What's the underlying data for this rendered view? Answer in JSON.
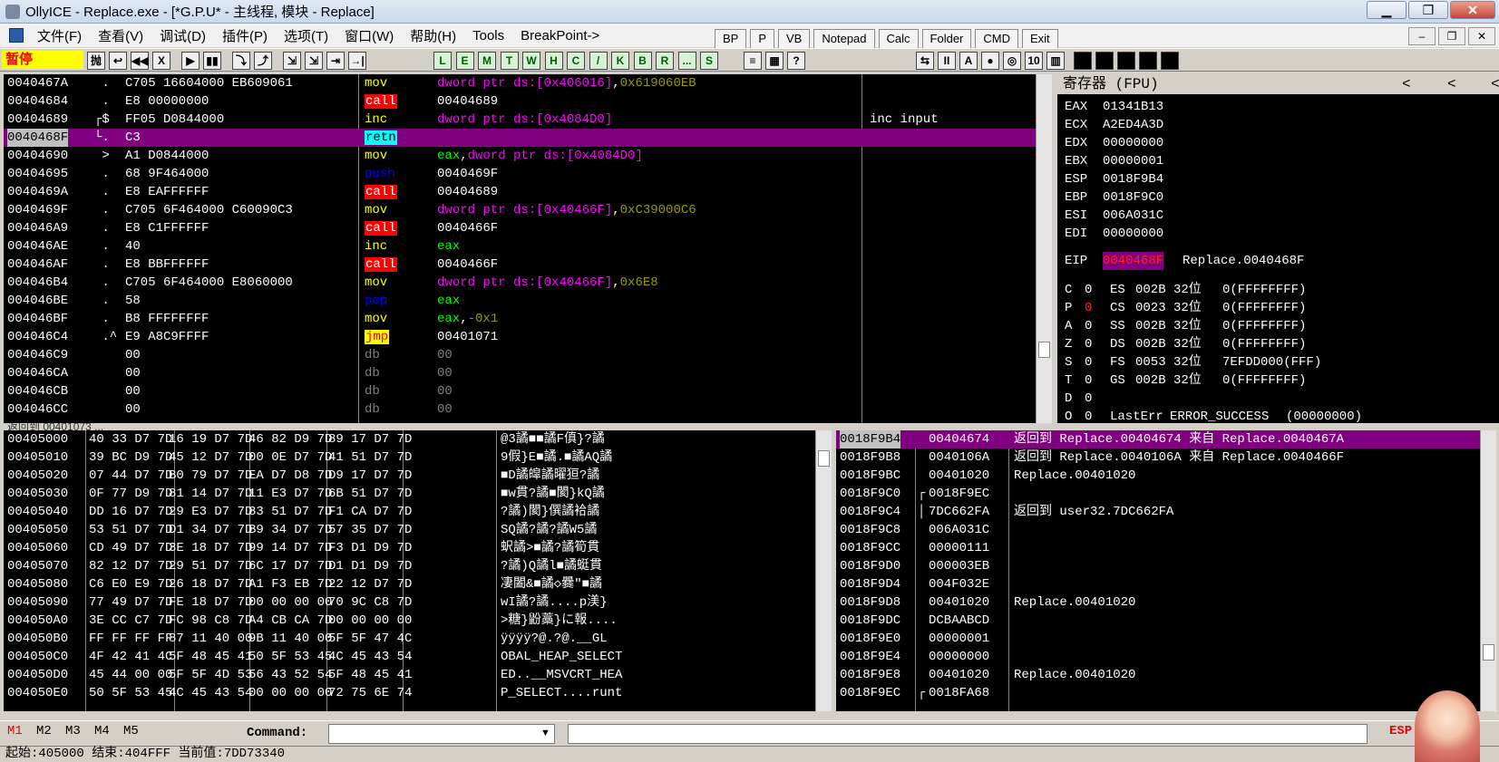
{
  "title": "OllyICE - Replace.exe - [*G.P.U* - 主线程, 模块 - Replace]",
  "window_buttons": {
    "min": "▁",
    "max": "❐",
    "close": "✕"
  },
  "menu": [
    "文件(F)",
    "查看(V)",
    "调试(D)",
    "插件(P)",
    "选项(T)",
    "窗口(W)",
    "帮助(H)",
    "Tools",
    "BreakPoint->"
  ],
  "top_buttons": [
    "BP",
    "P",
    "VB",
    "Notepad",
    "Calc",
    "Folder",
    "CMD",
    "Exit"
  ],
  "mdi_buttons": [
    "–",
    "❐",
    "✕"
  ],
  "status": {
    "paused": "暂停"
  },
  "toolbar": {
    "left": [
      "抛",
      "↩",
      "◀◀",
      "X",
      "▶",
      "▮▮",
      "⤵",
      "⤴",
      "⇲",
      "⇲",
      "⇥",
      "→|"
    ],
    "letters": [
      "L",
      "E",
      "M",
      "T",
      "W",
      "H",
      "C",
      "/",
      "K",
      "B",
      "R",
      "...",
      "S"
    ],
    "right": [
      "≡",
      "▦",
      "?"
    ],
    "right2": [
      "⇆",
      "II",
      "A",
      "●",
      "◎",
      "10",
      "▥"
    ]
  },
  "disasm": {
    "rows": [
      {
        "addr": "0040467A",
        "mark": " .",
        "hex": "C705 16604000 EB609061",
        "op": "mov",
        "args": [
          {
            "t": "dword ptr ds:[0x406016]",
            "c": "#ff00ff"
          },
          {
            "t": ",",
            "c": "#fff"
          },
          {
            "t": "0x619060EB",
            "c": "#9a9a00"
          }
        ],
        "cmt": ""
      },
      {
        "addr": "00404684",
        "mark": " .",
        "hex": "E8 00000000",
        "op": "call",
        "opk": "mk",
        "args": [
          {
            "t": "00404689",
            "c": "#fff"
          }
        ],
        "cmt": ""
      },
      {
        "addr": "00404689",
        "mark": "┌$",
        "hex": "FF05 D0844000",
        "op": "inc",
        "args": [
          {
            "t": "dword ptr ds:[0x4084D0]",
            "c": "#ff00ff"
          }
        ],
        "cmt": "inc input"
      },
      {
        "addr": "0040468F",
        "mark": "└.",
        "hex": "C3",
        "op": "retn",
        "opk": "mkr",
        "args": [],
        "cmt": "",
        "sel": true
      },
      {
        "addr": "00404690",
        "mark": " >",
        "hex": "A1 D0844000",
        "op": "mov",
        "args": [
          {
            "t": "eax",
            "c": "#00ff00"
          },
          {
            "t": ",",
            "c": "#fff"
          },
          {
            "t": "dword ptr ds:[0x4084D0]",
            "c": "#ff00ff"
          }
        ],
        "cmt": ""
      },
      {
        "addr": "00404695",
        "mark": " .",
        "hex": "68 9F464000",
        "op": "push",
        "opc": "#0000ff",
        "args": [
          {
            "t": "0040469F",
            "c": "#fff"
          }
        ],
        "cmt": ""
      },
      {
        "addr": "0040469A",
        "mark": " .",
        "hex": "E8 EAFFFFFF",
        "op": "call",
        "opk": "mk",
        "args": [
          {
            "t": "00404689",
            "c": "#fff"
          }
        ],
        "cmt": ""
      },
      {
        "addr": "0040469F",
        "mark": " .",
        "hex": "C705 6F464000 C60090C3",
        "op": "mov",
        "args": [
          {
            "t": "dword ptr ds:[0x40466F]",
            "c": "#ff00ff"
          },
          {
            "t": ",",
            "c": "#fff"
          },
          {
            "t": "0xC39000C6",
            "c": "#9a9a00"
          }
        ],
        "cmt": ""
      },
      {
        "addr": "004046A9",
        "mark": " .",
        "hex": "E8 C1FFFFFF",
        "op": "call",
        "opk": "mk",
        "args": [
          {
            "t": "0040466F",
            "c": "#fff"
          }
        ],
        "cmt": ""
      },
      {
        "addr": "004046AE",
        "mark": " .",
        "hex": "40",
        "op": "inc",
        "args": [
          {
            "t": "eax",
            "c": "#00ff00"
          }
        ],
        "cmt": ""
      },
      {
        "addr": "004046AF",
        "mark": " .",
        "hex": "E8 BBFFFFFF",
        "op": "call",
        "opk": "mk",
        "args": [
          {
            "t": "0040466F",
            "c": "#fff"
          }
        ],
        "cmt": ""
      },
      {
        "addr": "004046B4",
        "mark": " .",
        "hex": "C705 6F464000 E8060000",
        "op": "mov",
        "args": [
          {
            "t": "dword ptr ds:[0x40466F]",
            "c": "#ff00ff"
          },
          {
            "t": ",",
            "c": "#fff"
          },
          {
            "t": "0x6E8",
            "c": "#9a9a00"
          }
        ],
        "cmt": ""
      },
      {
        "addr": "004046BE",
        "mark": " .",
        "hex": "58",
        "op": "pop",
        "opc": "#0000ff",
        "args": [
          {
            "t": "eax",
            "c": "#00ff00"
          }
        ],
        "cmt": ""
      },
      {
        "addr": "004046BF",
        "mark": " .",
        "hex": "B8 FFFFFFFF",
        "op": "mov",
        "args": [
          {
            "t": "eax",
            "c": "#00ff00"
          },
          {
            "t": ",",
            "c": "#fff"
          },
          {
            "t": "-0x1",
            "c": "#9a9a00"
          }
        ],
        "cmt": ""
      },
      {
        "addr": "004046C4",
        "mark": " .^",
        "hex": "E9 A8C9FFFF",
        "op": "jmp",
        "opk": "mkj",
        "args": [
          {
            "t": "00401071",
            "c": "#fff"
          }
        ],
        "cmt": ""
      },
      {
        "addr": "004046C9",
        "mark": "",
        "hex": "00",
        "op": "db",
        "opc": "#808080",
        "args": [
          {
            "t": "00",
            "c": "#808080"
          }
        ],
        "cmt": ""
      },
      {
        "addr": "004046CA",
        "mark": "",
        "hex": "00",
        "op": "db",
        "opc": "#808080",
        "args": [
          {
            "t": "00",
            "c": "#808080"
          }
        ],
        "cmt": ""
      },
      {
        "addr": "004046CB",
        "mark": "",
        "hex": "00",
        "op": "db",
        "opc": "#808080",
        "args": [
          {
            "t": "00",
            "c": "#808080"
          }
        ],
        "cmt": ""
      },
      {
        "addr": "004046CC",
        "mark": "",
        "hex": "00",
        "op": "db",
        "opc": "#808080",
        "args": [
          {
            "t": "00",
            "c": "#808080"
          }
        ],
        "cmt": ""
      }
    ]
  },
  "registers": {
    "title": "寄存器 (FPU)",
    "nav": [
      "<",
      "<",
      "<"
    ],
    "gpr": [
      [
        "EAX",
        "01341B13"
      ],
      [
        "ECX",
        "A2ED4A3D"
      ],
      [
        "EDX",
        "00000000"
      ],
      [
        "EBX",
        "00000001"
      ],
      [
        "ESP",
        "0018F9B4"
      ],
      [
        "EBP",
        "0018F9C0"
      ],
      [
        "ESI",
        "006A031C"
      ],
      [
        "EDI",
        "00000000"
      ]
    ],
    "eip": {
      "name": "EIP",
      "value": "0040468F",
      "desc": "Replace.0040468F"
    },
    "flags": [
      {
        "f": "C",
        "v": "0",
        "seg": "ES",
        "sv": "002B",
        "bits": "32位",
        "rest": "0(FFFFFFFF)"
      },
      {
        "f": "P",
        "v": "0",
        "seg": "CS",
        "sv": "0023",
        "bits": "32位",
        "rest": "0(FFFFFFFF)",
        "red": true
      },
      {
        "f": "A",
        "v": "0",
        "seg": "SS",
        "sv": "002B",
        "bits": "32位",
        "rest": "0(FFFFFFFF)"
      },
      {
        "f": "Z",
        "v": "0",
        "seg": "DS",
        "sv": "002B",
        "bits": "32位",
        "rest": "0(FFFFFFFF)"
      },
      {
        "f": "S",
        "v": "0",
        "seg": "FS",
        "sv": "0053",
        "bits": "32位",
        "rest": "7EFDD000(FFF)"
      },
      {
        "f": "T",
        "v": "0",
        "seg": "GS",
        "sv": "002B",
        "bits": "32位",
        "rest": "0(FFFFFFFF)"
      },
      {
        "f": "D",
        "v": "0",
        "seg": "",
        "sv": "",
        "bits": "",
        "rest": ""
      },
      {
        "f": "O",
        "v": "0",
        "seg": "LastErr",
        "sv": "ERROR_SUCCESS",
        "bits": "",
        "rest": "(00000000)"
      }
    ]
  },
  "info_line": "返回到 00401073 ...",
  "dump": {
    "rows": [
      {
        "a": "00405000",
        "h": [
          "40 33 D7 7D",
          "16 19 D7 7D",
          "46 82 D9 7D",
          "89 17 D7 7D"
        ],
        "s": "@3譎■■譎F傎}?譎"
      },
      {
        "a": "00405010",
        "h": [
          "39 BC D9 7D",
          "45 12 D7 7D",
          "00 0E D7 7D",
          "41 51 D7 7D"
        ],
        "s": "9假}E■譎.■譎AQ譎"
      },
      {
        "a": "00405020",
        "h": [
          "07 44 D7 7D",
          "B0 79 D7 7D",
          "EA D7 D8 7D",
          "D9 17 D7 7D"
        ],
        "s": "■D譎皡譎曜狟?譎"
      },
      {
        "a": "00405030",
        "h": [
          "0F 77 D9 7D",
          "81 14 D7 7D",
          "11 E3 D7 7D",
          "6B 51 D7 7D"
        ],
        "s": "■w貫?譎■閡}kQ譎"
      },
      {
        "a": "00405040",
        "h": [
          "DD 16 D7 7D",
          "29 E3 D7 7D",
          "83 51 D7 7D",
          "F1 CA D7 7D"
        ],
        "s": "?譎)閡}僎譎袷譎"
      },
      {
        "a": "00405050",
        "h": [
          "53 51 D7 7D",
          "D1 34 D7 7D",
          "B9 34 D7 7D",
          "57 35 D7 7D"
        ],
        "s": "SQ譎?譎?譎W5譎"
      },
      {
        "a": "00405060",
        "h": [
          "CD 49 D7 7D",
          "3E 18 D7 7D",
          "99 14 D7 7D",
          "F3 D1 D9 7D"
        ],
        "s": "蚇譎>■譎?譎筍貫"
      },
      {
        "a": "00405070",
        "h": [
          "82 12 D7 7D",
          "29 51 D7 7D",
          "6C 17 D7 7D",
          "D1 D1 D9 7D"
        ],
        "s": "?譎)Q譎l■譎蜓貫"
      },
      {
        "a": "00405080",
        "h": [
          "C6 E0 E9 7D",
          "26 18 D7 7D",
          "A1 F3 EB 7D",
          "22 12 D7 7D"
        ],
        "s": "凄闔&■譎◇爨\"■譎"
      },
      {
        "a": "00405090",
        "h": [
          "77 49 D7 7D",
          "FE 18 D7 7D",
          "00 00 00 00",
          "70 9C C8 7D"
        ],
        "s": "wI譎?譎....p渼}"
      },
      {
        "a": "004050A0",
        "h": [
          "3E CC C7 7D",
          "FC 98 C8 7D",
          "A4 CB CA 7D",
          "00 00 00 00"
        ],
        "s": ">糖}鼢藁}に報...."
      },
      {
        "a": "004050B0",
        "h": [
          "FF FF FF FF",
          "87 11 40 00",
          "9B 11 40 00",
          "5F 5F 47 4C"
        ],
        "s": "ÿÿÿÿ?@.?@.__GL"
      },
      {
        "a": "004050C0",
        "h": [
          "4F 42 41 4C",
          "5F 48 45 41",
          "50 5F 53 45",
          "4C 45 43 54"
        ],
        "s": "OBAL_HEAP_SELECT"
      },
      {
        "a": "004050D0",
        "h": [
          "45 44 00 00",
          "5F 5F 4D 53",
          "56 43 52 54",
          "5F 48 45 41"
        ],
        "s": "ED..__MSVCRT_HEA"
      },
      {
        "a": "004050E0",
        "h": [
          "50 5F 53 45",
          "4C 45 43 54",
          "00 00 00 00",
          "72 75 6E 74"
        ],
        "s": "P_SELECT....runt"
      }
    ]
  },
  "stack": {
    "rows": [
      {
        "a": "0018F9B4",
        "v": "00404674",
        "t": "返回到 Replace.00404674 来自 Replace.0040467A",
        "sel": true
      },
      {
        "a": "0018F9B8",
        "v": "0040106A",
        "t": "返回到 Replace.0040106A 来自 Replace.0040466F"
      },
      {
        "a": "0018F9BC",
        "v": "00401020",
        "t": "Replace.00401020"
      },
      {
        "a": "0018F9C0",
        "v": "0018F9EC",
        "t": "",
        "mk": "┌"
      },
      {
        "a": "0018F9C4",
        "v": "7DC662FA",
        "t": "返回到 user32.7DC662FA",
        "mk": "│"
      },
      {
        "a": "0018F9C8",
        "v": "006A031C",
        "t": ""
      },
      {
        "a": "0018F9CC",
        "v": "00000111",
        "t": ""
      },
      {
        "a": "0018F9D0",
        "v": "000003EB",
        "t": ""
      },
      {
        "a": "0018F9D4",
        "v": "004F032E",
        "t": ""
      },
      {
        "a": "0018F9D8",
        "v": "00401020",
        "t": "Replace.00401020"
      },
      {
        "a": "0018F9DC",
        "v": "DCBAABCD",
        "t": ""
      },
      {
        "a": "0018F9E0",
        "v": "00000001",
        "t": ""
      },
      {
        "a": "0018F9E4",
        "v": "00000000",
        "t": ""
      },
      {
        "a": "0018F9E8",
        "v": "00401020",
        "t": "Replace.00401020"
      },
      {
        "a": "0018F9EC",
        "v": "0018FA68",
        "t": "",
        "mk": "┌"
      }
    ]
  },
  "command": {
    "tabs": [
      "M1",
      "M2",
      "M3",
      "M4",
      "M5"
    ],
    "label": "Command:",
    "value": "",
    "right_label": "ESP"
  },
  "statusline": "起始:405000 结束:404FFF 当前值:7DD73340"
}
